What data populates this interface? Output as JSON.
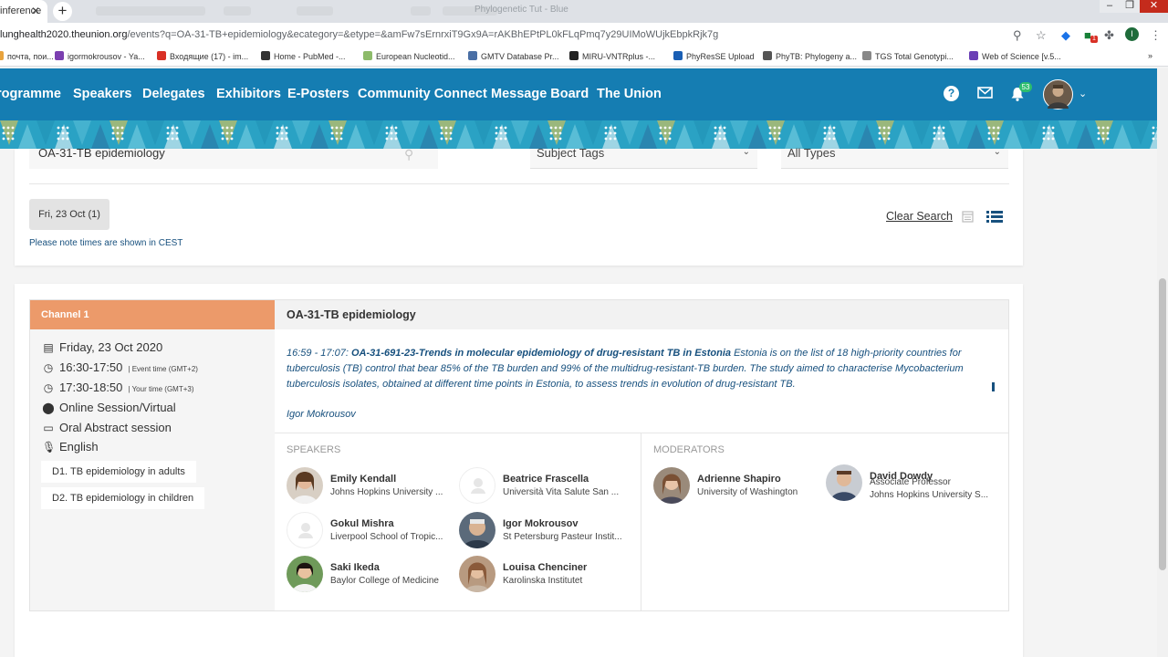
{
  "browser": {
    "tab_title": "inference",
    "window_title": "Phylogenetic Tut - Blue",
    "url_host": "lunghealth2020.theunion.org",
    "url_rest": "/events?q=OA-31-TB+epidemiology&ecategory=&etype=&amFw7sErnrxiT9Gx9A=rAKBhEPtPL0kFLqPmq7y29UIMoWUjkEbpkRjk7g",
    "extension_badge": "1",
    "profile_initial": "I",
    "bookmarks": [
      {
        "label": "почта, пои...",
        "color": "#e8a33d"
      },
      {
        "label": "igormokrousov - Ya...",
        "color": "#7b3fb0"
      },
      {
        "label": "Входящие (17) - im...",
        "color": "#d93025"
      },
      {
        "label": "Home - PubMed -...",
        "color": "#333333"
      },
      {
        "label": "European Nucleotid...",
        "color": "#8dbb6a"
      },
      {
        "label": "GMTV Database Pr...",
        "color": "#4a6fa5"
      },
      {
        "label": "MIRU-VNTRplus -...",
        "color": "#222222"
      },
      {
        "label": "PhyResSE Upload",
        "color": "#1a5fb4"
      },
      {
        "label": "PhyTB: Phylogeny a...",
        "color": "#555555"
      },
      {
        "label": "TGS Total Genotypi...",
        "color": "#888888"
      },
      {
        "label": "Web of Science [v.5...",
        "color": "#6a3fb5"
      }
    ]
  },
  "nav": {
    "items": [
      "rogramme",
      "Speakers",
      "Delegates",
      "Exhibitors",
      "E-Posters",
      "Community Connect",
      "Message Board",
      "The Union"
    ],
    "notification_count": "53",
    "help_glyph": "?"
  },
  "search": {
    "query": "OA-31-TB epidemiology",
    "subject_tags": "Subject Tags",
    "all_types": "All Types",
    "date_filter": "Fri, 23 Oct (1)",
    "note": "Please note times are shown in CEST",
    "clear_label": "Clear Search"
  },
  "session": {
    "channel": "Channel 1",
    "date": "Friday, 23 Oct 2020",
    "event_time": "16:30-17:50",
    "event_time_note": "| Event time (GMT+2)",
    "your_time": "17:30-18:50",
    "your_time_note": "| Your time (GMT+3)",
    "location": "Online Session/Virtual",
    "type": "Oral Abstract session",
    "language": "English",
    "tags": [
      "D1. TB epidemiology in adults",
      "D2. TB epidemiology in children"
    ],
    "title": "OA-31-TB epidemiology",
    "abstract_time": "16:59 - 17:07:",
    "abstract_title": "OA-31-691-23-Trends in molecular epidemiology of drug-resistant TB in Estonia",
    "abstract_text": "Estonia is on the list of 18 high-priority countries for tuberculosis (TB) control that bear 85% of the TB burden and 99% of the multidrug-resistant-TB burden. The study aimed to characterise Mycobacterium tuberculosis isolates, obtained at different time points in Estonia, to assess trends in evolution of drug-resistant TB.",
    "abstract_author": "Igor Mokrousov",
    "speakers_label": "SPEAKERS",
    "moderators_label": "MODERATORS",
    "speakers": [
      {
        "name": "Emily Kendall",
        "affiliation": "Johns Hopkins University ..."
      },
      {
        "name": "Beatrice Frascella",
        "affiliation": "Università Vita Salute San ..."
      },
      {
        "name": "Gokul Mishra",
        "affiliation": "Liverpool School of Tropic..."
      },
      {
        "name": "Igor Mokrousov",
        "affiliation": "St Petersburg Pasteur Instit..."
      },
      {
        "name": "Saki Ikeda",
        "affiliation": "Baylor College of Medicine"
      },
      {
        "name": "Louisa Chenciner",
        "affiliation": "Karolinska Institutet"
      }
    ],
    "moderators": [
      {
        "name": "Adrienne Shapiro",
        "affiliation": "University of Washington"
      },
      {
        "name": "David Dowdy",
        "title": "Associate Professor",
        "affiliation": "Johns Hopkins University S..."
      }
    ]
  },
  "colors": {
    "nav_blue": "#157db2",
    "channel_orange": "#ec9a6a",
    "link_dark_blue": "#17507e",
    "badge_green": "#2dbd6e"
  }
}
